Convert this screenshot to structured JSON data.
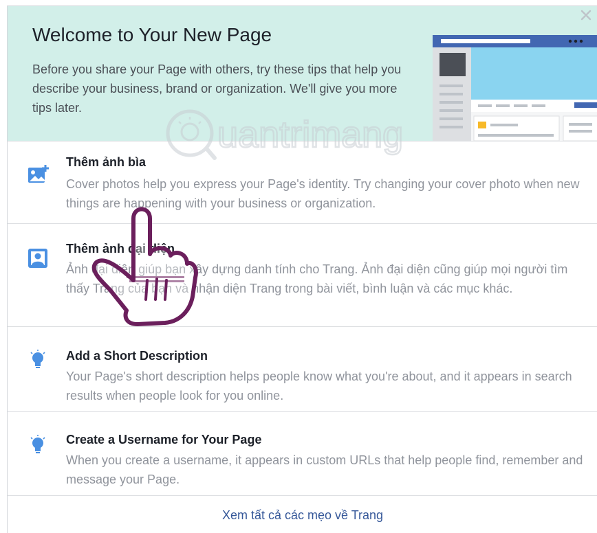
{
  "header": {
    "title": "Welcome to Your New Page",
    "description": "Before you share your Page with others, try these tips that help you describe your business, brand or organization. We'll give you more tips later."
  },
  "tips": [
    {
      "icon": "add-photo-icon",
      "title": "Thêm ảnh bìa",
      "description": "Cover photos help you express your Page's identity. Try changing your cover photo when new things are happening with your business or organization."
    },
    {
      "icon": "profile-picture-icon",
      "title": "Thêm ảnh đại diện",
      "description": "Ảnh đại diện giúp bạn xây dựng danh tính cho Trang. Ảnh đại diện cũng giúp mọi người tìm thấy Trang của bạn và nhận diện Trang trong bài viết, bình luận và các mục khác."
    },
    {
      "icon": "lightbulb-icon",
      "title": "Add a Short Description",
      "description": "Your Page's short description helps people know what you're about, and it appears in search results when people look for you online."
    },
    {
      "icon": "lightbulb-icon",
      "title": "Create a Username for Your Page",
      "description": "When you create a username, it appears in custom URLs that help people find, remember and message your Page."
    }
  ],
  "footer": {
    "link": "Xem tất cả các mẹo về Trang"
  },
  "watermark": {
    "text": "uantrimang"
  },
  "colors": {
    "header_bg": "#d2efe9",
    "icon_blue": "#4a90e2",
    "link": "#365899",
    "title_text": "#1d2129",
    "muted_text": "#90949c",
    "hand_outline": "#6b1f5c"
  }
}
